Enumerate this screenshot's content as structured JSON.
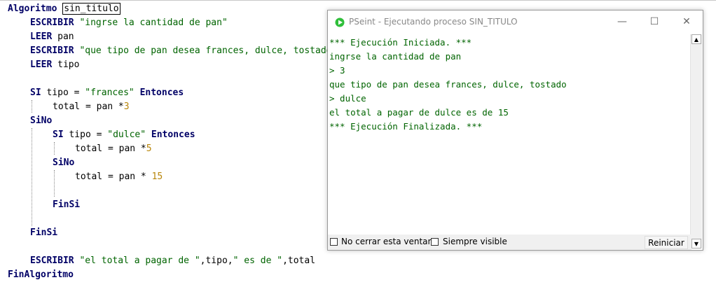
{
  "editor": {
    "line1": {
      "kw": "Algoritmo",
      "name": "sin_titulo"
    },
    "line2": {
      "kw": "ESCRIBIR",
      "str": "\"ingrse la cantidad de pan\""
    },
    "line3": {
      "kw": "LEER",
      "var": "pan"
    },
    "line4": {
      "kw": "ESCRIBIR",
      "str": "\"que tipo de pan desea frances, dulce, tostado\""
    },
    "line5": {
      "kw": "LEER",
      "var": "tipo"
    },
    "line6": {
      "kw": "SI",
      "a": "tipo = ",
      "str": "\"frances\"",
      "kw2": "Entonces"
    },
    "line7": {
      "a": "total = pan *",
      "num": "3"
    },
    "line8": {
      "kw": "SiNo"
    },
    "line9": {
      "kw": "SI",
      "a": "tipo = ",
      "str": "\"dulce\"",
      "kw2": "Entonces"
    },
    "line10": {
      "a": "total = pan *",
      "num": "5"
    },
    "line11": {
      "kw": "SiNo"
    },
    "line12": {
      "a": "total = pan * ",
      "num": "15"
    },
    "line13": {
      "kw": "FinSi"
    },
    "line14": {
      "kw": "FinSi"
    },
    "line15": {
      "kw": "ESCRIBIR",
      "s1": "\"el total a pagar de \"",
      "a": ",tipo,",
      "s2": "\" es de \"",
      "b": ",total"
    },
    "line16": {
      "kw": "FinAlgoritmo"
    }
  },
  "console": {
    "title": "PSeint - Ejecutando proceso SIN_TITULO",
    "minimize": "—",
    "maximize": "☐",
    "close": "✕",
    "output": [
      "*** Ejecución Iniciada. ***",
      "ingrse la cantidad de pan",
      "> 3",
      "que tipo de pan desea frances, dulce, tostado",
      "> dulce",
      "el total a pagar de dulce es de 15",
      "*** Ejecución Finalizada. ***"
    ],
    "no_cerrar": "No cerrar esta ventana",
    "siempre_visible": "Siempre visible",
    "reiniciar": "Reiniciar",
    "accent_color": "#2fbf3a"
  }
}
